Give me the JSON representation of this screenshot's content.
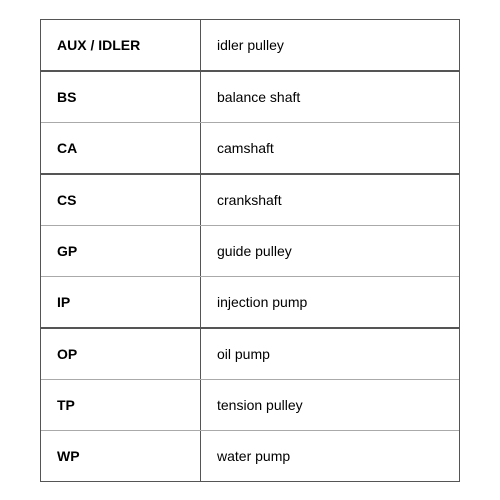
{
  "table": {
    "rows": [
      {
        "code": "AUX / IDLER",
        "description": "idler pulley",
        "thick": true
      },
      {
        "code": "BS",
        "description": "balance shaft",
        "thick": false
      },
      {
        "code": "CA",
        "description": "camshaft",
        "thick": true
      },
      {
        "code": "CS",
        "description": "crankshaft",
        "thick": false
      },
      {
        "code": "GP",
        "description": "guide pulley",
        "thick": false
      },
      {
        "code": "IP",
        "description": "injection pump",
        "thick": true
      },
      {
        "code": "OP",
        "description": "oil pump",
        "thick": false
      },
      {
        "code": "TP",
        "description": "tension pulley",
        "thick": false
      },
      {
        "code": "WP",
        "description": "water pump",
        "thick": false
      }
    ]
  }
}
